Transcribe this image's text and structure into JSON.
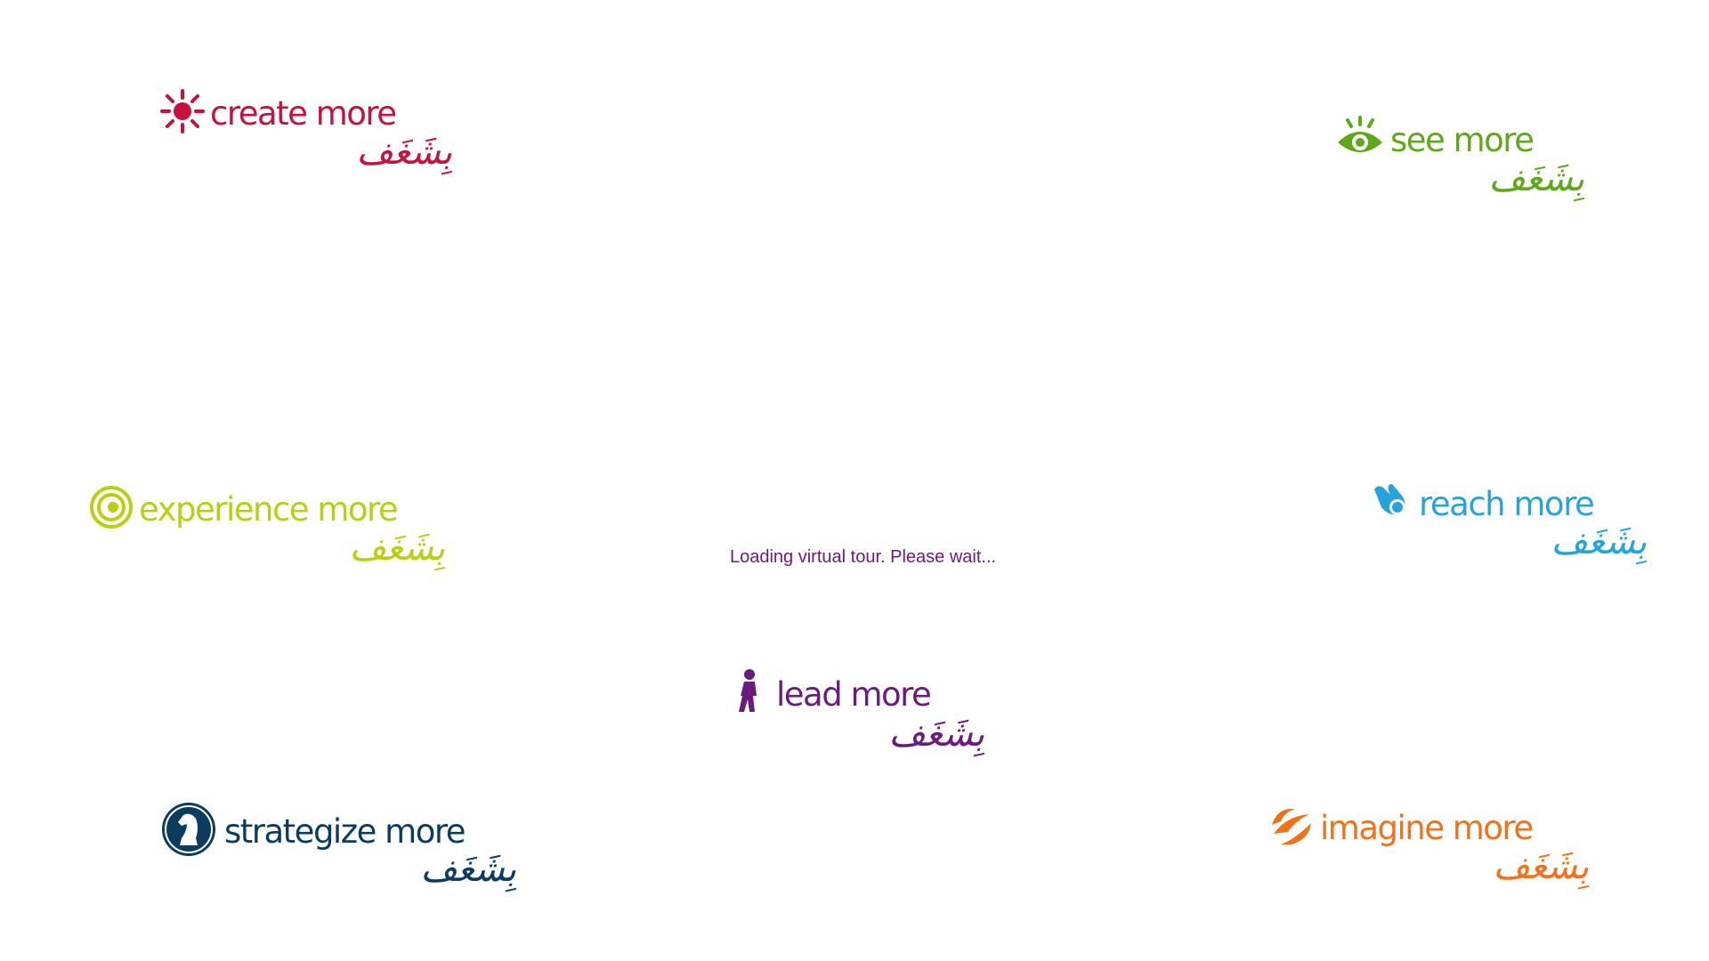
{
  "loading_text": "Loading virtual tour. Please wait...",
  "logos": {
    "create": {
      "text": "create more",
      "arabic": "بِشَغَف",
      "color": "#c8103e",
      "icon": "sun-icon"
    },
    "see": {
      "text": "see more",
      "arabic": "بِشَغَف",
      "color": "#5fa81c",
      "icon": "eye-icon"
    },
    "experience": {
      "text": "experience more",
      "arabic": "بِشَغَف",
      "color": "#b9cf12",
      "icon": "swirl-icon"
    },
    "reach": {
      "text": "reach more",
      "arabic": "بِشَغَف",
      "color": "#27a3dc",
      "icon": "hand-icon"
    },
    "lead": {
      "text": "lead more",
      "arabic": "بِشَغَف",
      "color": "#6a1b7e",
      "icon": "walking-person-icon"
    },
    "strategize": {
      "text": "strategize more",
      "arabic": "بِشَغَف",
      "color": "#0d3b5e",
      "icon": "chess-knight-icon"
    },
    "imagine": {
      "text": "imagine more",
      "arabic": "بِشَغَف",
      "color": "#f0731c",
      "icon": "swoosh-icon"
    }
  }
}
